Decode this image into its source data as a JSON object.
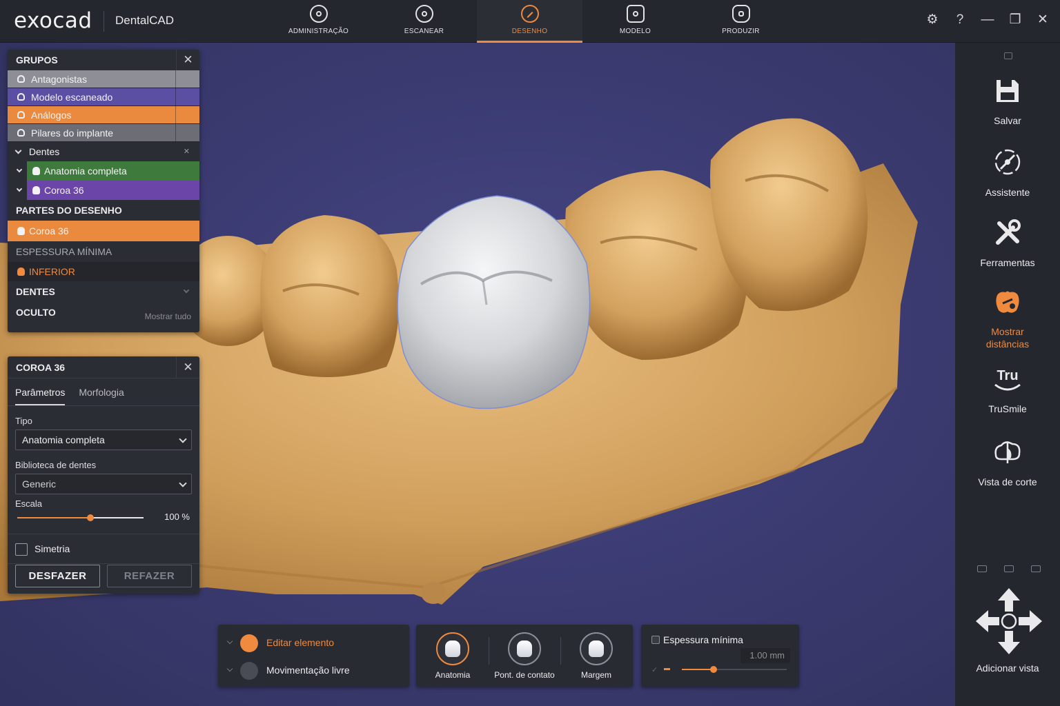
{
  "app": {
    "logo": "exocad",
    "product": "DentalCAD"
  },
  "nav": {
    "tabs": [
      {
        "label": "ADMINISTRAÇÃO",
        "icon": "admin-icon",
        "active": false
      },
      {
        "label": "ESCANEAR",
        "icon": "scan-icon",
        "active": false
      },
      {
        "label": "DESENHO",
        "icon": "pencil-icon",
        "active": true
      },
      {
        "label": "MODELO",
        "icon": "model-icon",
        "active": false
      },
      {
        "label": "PRODUZIR",
        "icon": "produce-icon",
        "active": false
      }
    ]
  },
  "window_controls": {
    "settings": "⚙",
    "help": "?",
    "minimize": "—",
    "restore": "❐",
    "close": "✕"
  },
  "groups_panel": {
    "title": "GRUPOS",
    "rows": [
      {
        "label": "Antagonistas",
        "color": "#8e8f96"
      },
      {
        "label": "Modelo escaneado",
        "color": "#5b4fa3"
      },
      {
        "label": "Análogos",
        "color": "#ea8a3f"
      },
      {
        "label": "Pilares do implante",
        "color": "#6d6e75"
      }
    ],
    "teeth_group": "Dentes",
    "teeth_items": [
      {
        "label": "Anatomia completa",
        "color": "#3f7a3d"
      },
      {
        "label": "Coroa 36",
        "color": "#6b46a8"
      }
    ],
    "parts_title": "PARTES DO DESENHO",
    "parts_active": "Coroa 36",
    "min_thickness": "ESPESSURA MÍNIMA",
    "lower": "INFERIOR",
    "teeth_title": "DENTES",
    "hidden_title": "OCULTO",
    "show_all": "Mostrar tudo"
  },
  "crown_panel": {
    "title": "COROA 36",
    "tabs": [
      "Parâmetros",
      "Morfologia"
    ],
    "type_label": "Tipo",
    "type_value": "Anatomia completa",
    "library_label": "Biblioteca de dentes",
    "library_value": "Generic",
    "scale_label": "Escala",
    "scale_value": "100 %",
    "scale_fraction": 0.58,
    "symmetry_label": "Simetria",
    "undo": "DESFAZER",
    "redo": "REFAZER"
  },
  "bottom": {
    "edit_element": "Editar elemento",
    "free_move": "Movimentação livre",
    "modes": [
      "Anatomia",
      "Pont. de contato",
      "Margem"
    ],
    "thickness_label": "Espessura mínima",
    "thickness_value": "1.00 mm",
    "thickness_fraction": 0.3
  },
  "rightbar": {
    "items": [
      {
        "label": "Salvar",
        "icon": "save-icon"
      },
      {
        "label": "Assistente",
        "icon": "wizard-icon"
      },
      {
        "label": "Ferramentas",
        "icon": "tools-icon"
      },
      {
        "label": "Mostrar\ndistâncias",
        "icon": "distance-icon",
        "active": true
      },
      {
        "label": "TruSmile",
        "icon": "trusmile-icon"
      },
      {
        "label": "Vista de corte",
        "icon": "cut-view-icon"
      }
    ],
    "tru_text": "Tru",
    "add_view": "Adicionar vista"
  },
  "colors": {
    "accent": "#f08a3e",
    "stone": "#d7a664",
    "crown": "#d9dadc"
  }
}
